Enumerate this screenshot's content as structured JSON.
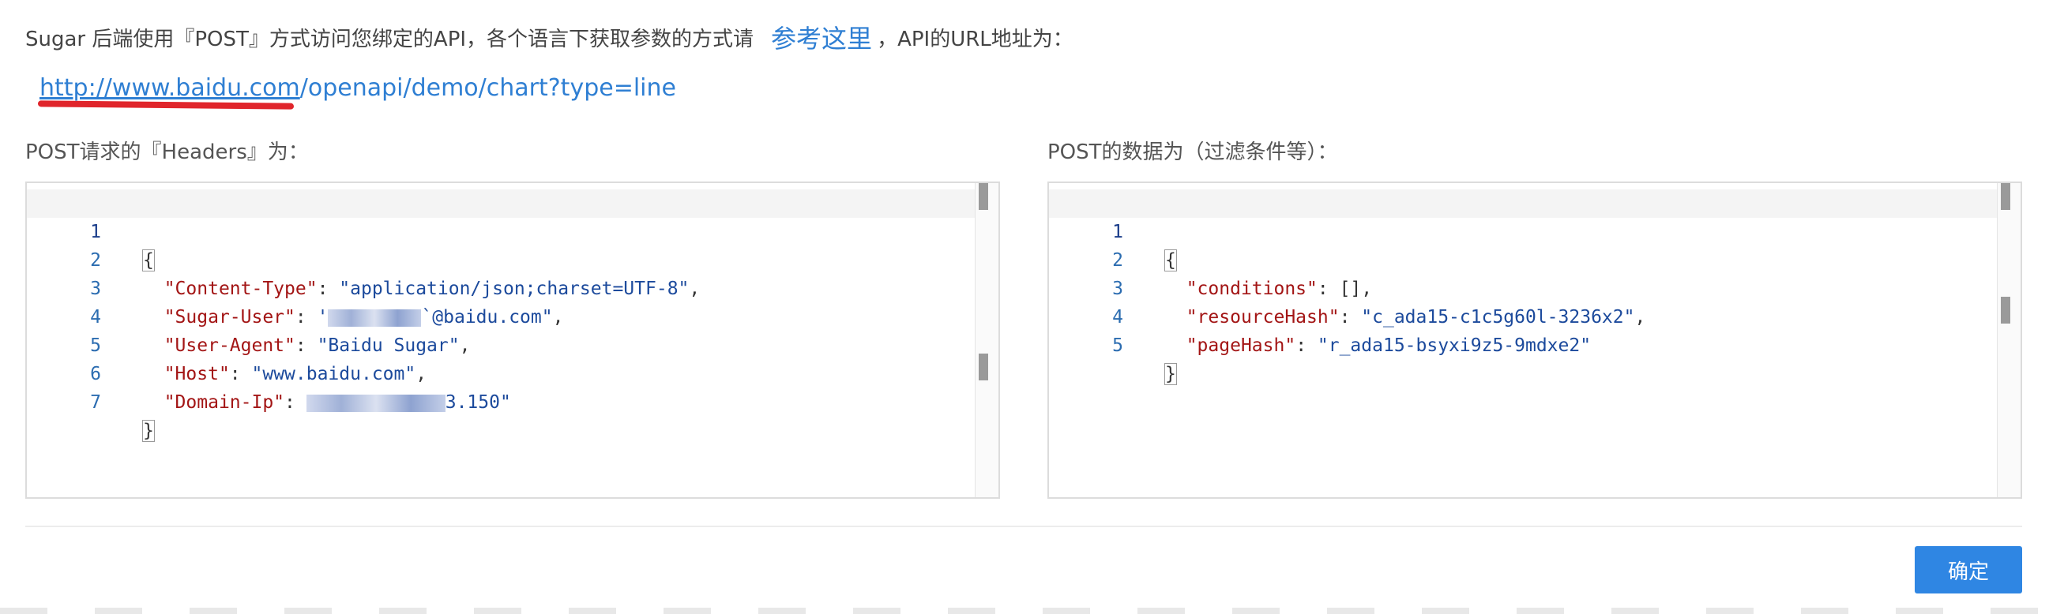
{
  "intro": {
    "text_before": "Sugar 后端使用『POST』方式访问您绑定的API，各个语言下获取参数的方式请",
    "link_label": "参考这里",
    "text_after": "，API的URL地址为："
  },
  "api_url": {
    "host": "http://www.baidu.com",
    "path": "/openapi/demo/chart?type=line"
  },
  "headers_panel": {
    "title": "POST请求的『Headers』为：",
    "lines": [
      {
        "num": "1",
        "open": "{"
      },
      {
        "num": "2",
        "key": "\"Content-Type\"",
        "value": "\"application/json;charset=UTF-8\"",
        "trail": ","
      },
      {
        "num": "3",
        "key": "\"Sugar-User\"",
        "value_prefix": "'",
        "value_suffix": "`@baidu.com\"",
        "trail": ","
      },
      {
        "num": "4",
        "key": "\"User-Agent\"",
        "value": "\"Baidu Sugar\"",
        "trail": ","
      },
      {
        "num": "5",
        "key": "\"Host\"",
        "value": "\"www.baidu.com\"",
        "trail": ","
      },
      {
        "num": "6",
        "key": "\"Domain-Ip\"",
        "value_suffix": "3.150\""
      },
      {
        "num": "7",
        "close": "}"
      }
    ]
  },
  "data_panel": {
    "title": "POST的数据为（过滤条件等）：",
    "lines": [
      {
        "num": "1",
        "open": "{"
      },
      {
        "num": "2",
        "key": "\"conditions\"",
        "value": "[]",
        "trail": ","
      },
      {
        "num": "3",
        "key": "\"resourceHash\"",
        "value": "\"c_ada15-c1c5g60l-3236x2\"",
        "trail": ","
      },
      {
        "num": "4",
        "key": "\"pageHash\"",
        "value": "\"r_ada15-bsyxi9z5-9mdxe2\""
      },
      {
        "num": "5",
        "close": "}"
      }
    ]
  },
  "footer": {
    "confirm_label": "确定"
  },
  "colors": {
    "link": "#2f7fd3",
    "json_key": "#a31515",
    "json_string": "#1c4a9c",
    "primary_button": "#2f86e3",
    "annotation_underline": "#e0252b"
  }
}
